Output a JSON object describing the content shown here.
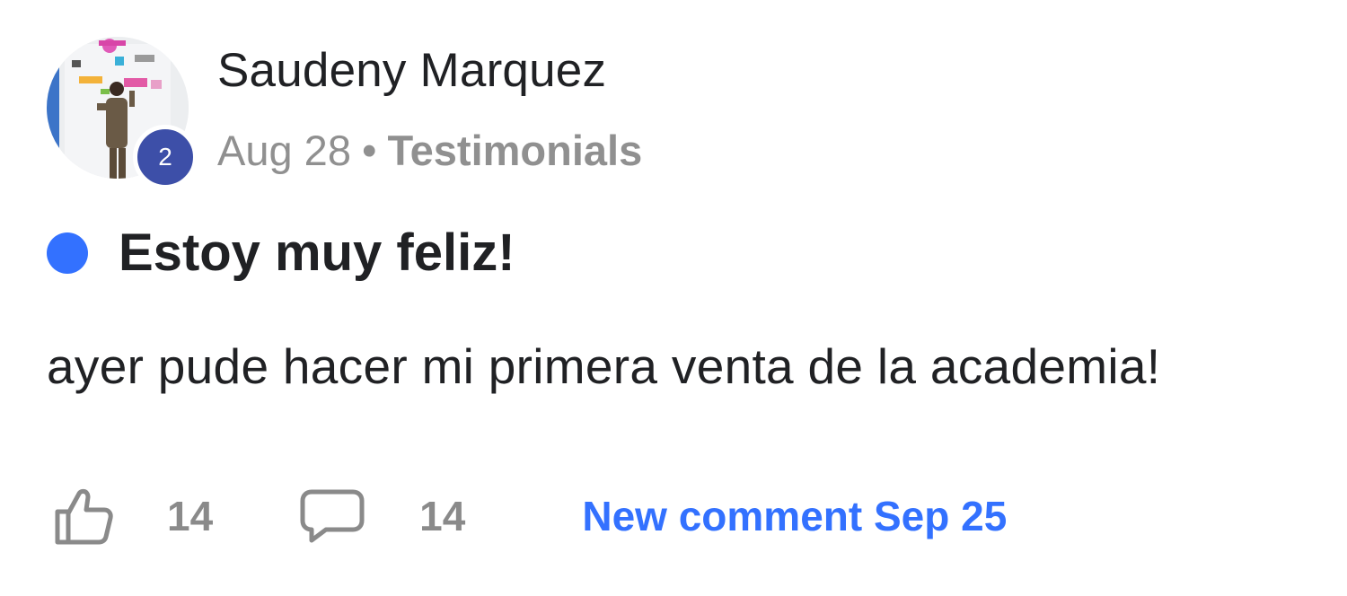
{
  "post": {
    "author": "Saudeny Marquez",
    "level": "2",
    "date": "Aug 28",
    "separator": "•",
    "category": "Testimonials",
    "title": "Estoy muy feliz!",
    "body": "ayer pude hacer mi primera venta de la academia!",
    "likes": "14",
    "comments": "14",
    "new_comment_label": "New comment Sep 25"
  },
  "colors": {
    "unread_dot": "#3371ff",
    "level_badge": "#3d4fa8",
    "link": "#3371ff",
    "muted": "#909090",
    "text": "#202124"
  },
  "icons": {
    "like": "thumbs-up-icon",
    "comment": "speech-bubble-icon"
  }
}
